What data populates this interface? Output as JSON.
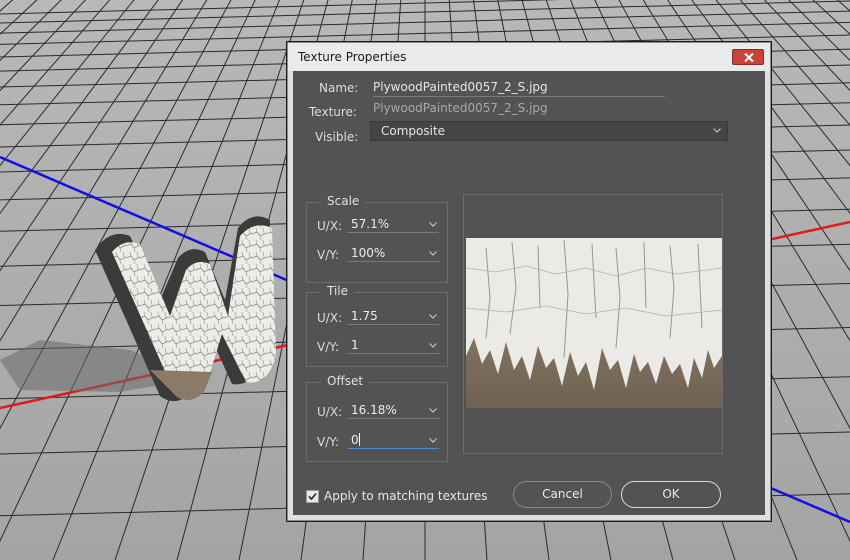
{
  "dialog": {
    "title": "Texture Properties",
    "name_label": "Name:",
    "name_value": "PlywoodPainted0057_2_S.jpg",
    "texture_label": "Texture:",
    "texture_value": "PlywoodPainted0057_2_S.jpg",
    "visible_label": "Visible:",
    "visible_value": "Composite",
    "scale": {
      "title": "Scale",
      "ux_label": "U/X:",
      "ux": "57.1%",
      "vy_label": "V/Y:",
      "vy": "100%"
    },
    "tile": {
      "title": "Tile",
      "ux_label": "U/X:",
      "ux": "1.75",
      "vy_label": "V/Y:",
      "vy": "1"
    },
    "offset": {
      "title": "Offset",
      "ux_label": "U/X:",
      "ux": "16.18%",
      "vy_label": "V/Y:",
      "vy": "0"
    },
    "apply_label": "Apply to matching textures",
    "apply_checked": true,
    "cancel_label": "Cancel",
    "ok_label": "OK"
  },
  "colors": {
    "dialog_bg": "#535353",
    "axis_red": "#e01a1a",
    "axis_blue": "#1010e0",
    "close_button": "#c9433b"
  }
}
